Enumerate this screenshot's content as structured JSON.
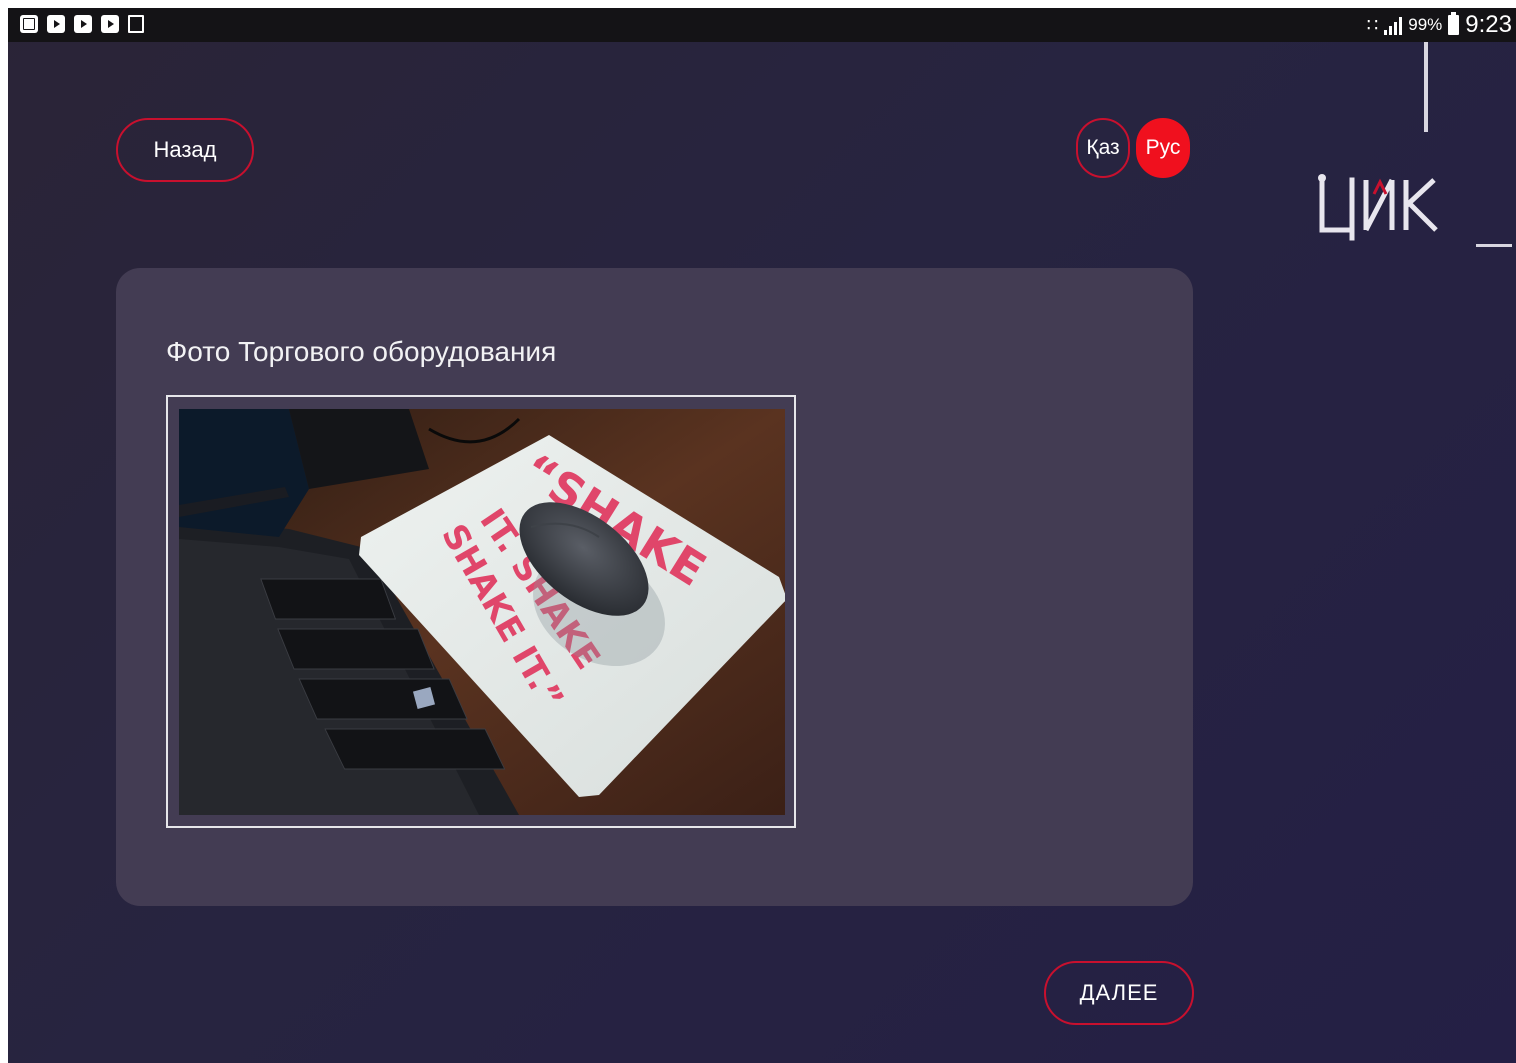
{
  "status_bar": {
    "left_icons": [
      "picture-notification-icon",
      "youtube-icon",
      "youtube-icon",
      "youtube-icon",
      "doc-notification-icon"
    ],
    "battery": "99%",
    "time": "9:23"
  },
  "header": {
    "back_label": "Назад",
    "lang_kaz": "Қаз",
    "lang_rus": "Рус",
    "active_lang": "rus"
  },
  "logo": {
    "text": "ЦИМК"
  },
  "card": {
    "title": "Фото Торгового оборудования",
    "photo_mousepad_text": [
      "“SHAKE",
      "IT. SHAKE",
      "SHAKE IT.”"
    ]
  },
  "footer": {
    "next_label": "ДАЛЕЕ"
  },
  "colors": {
    "accent_red": "#f0101e",
    "border_red": "#c8102e",
    "card_bg": "#433c53"
  }
}
